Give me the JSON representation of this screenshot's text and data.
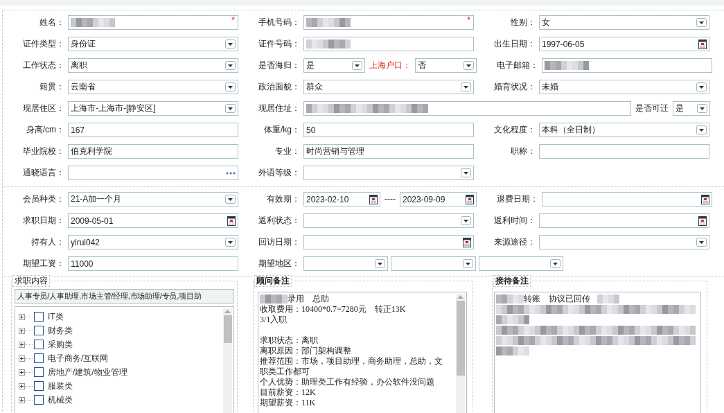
{
  "sections": [
    {
      "rows": [
        {
          "groups": [
            {
              "label": "姓名：",
              "controls": [
                {
                  "kind": "text",
                  "redacted": true,
                  "required_mark": "*"
                }
              ]
            },
            {
              "label": "手机号码：",
              "controls": [
                {
                  "kind": "text",
                  "redacted": true,
                  "required_mark": "*"
                }
              ]
            },
            {
              "label": "性别：",
              "controls": [
                {
                  "kind": "select",
                  "value": "女"
                }
              ]
            }
          ]
        },
        {
          "groups": [
            {
              "label": "证件类型：",
              "controls": [
                {
                  "kind": "select",
                  "value": "身份证"
                }
              ]
            },
            {
              "label": "证件号码：",
              "controls": [
                {
                  "kind": "text",
                  "redacted": true
                }
              ]
            },
            {
              "label": "出生日期：",
              "controls": [
                {
                  "kind": "date",
                  "value": "1997-06-05"
                }
              ]
            }
          ]
        },
        {
          "groups": [
            {
              "label": "工作状态：",
              "controls": [
                {
                  "kind": "select",
                  "value": "离职"
                }
              ]
            },
            {
              "label": "是否海归：",
              "controls": [
                {
                  "kind": "select",
                  "value": "是"
                },
                {
                  "kind": "label",
                  "text": "上海户口：",
                  "highlight": true
                },
                {
                  "kind": "select",
                  "value": "否"
                }
              ]
            },
            {
              "label": "电子邮箱：",
              "controls": [
                {
                  "kind": "text",
                  "redacted": true
                }
              ]
            }
          ]
        },
        {
          "groups": [
            {
              "label": "籍贯：",
              "controls": [
                {
                  "kind": "select",
                  "value": "云南省"
                }
              ]
            },
            {
              "label": "政治面貌：",
              "controls": [
                {
                  "kind": "select",
                  "value": "群众"
                }
              ]
            },
            {
              "label": "婚育状况：",
              "controls": [
                {
                  "kind": "select",
                  "value": "未婚"
                }
              ]
            }
          ]
        },
        {
          "groups": [
            {
              "label": "现居住区：",
              "controls": [
                {
                  "kind": "select",
                  "value": "上海市-上海市-[静安区]"
                }
              ]
            },
            {
              "label": "现居住址：",
              "controls": [
                {
                  "kind": "text",
                  "redacted": true
                },
                {
                  "kind": "label",
                  "text": "是否可迁",
                  "highlight": false
                },
                {
                  "kind": "select",
                  "value": "是"
                }
              ]
            }
          ]
        },
        {
          "groups": [
            {
              "label": "身高/cm：",
              "controls": [
                {
                  "kind": "text",
                  "value": "167"
                }
              ]
            },
            {
              "label": "体重/kg：",
              "controls": [
                {
                  "kind": "text",
                  "value": "50"
                }
              ]
            },
            {
              "label": "文化程度：",
              "controls": [
                {
                  "kind": "select",
                  "value": "本科（全日制）"
                }
              ]
            }
          ]
        },
        {
          "groups": [
            {
              "label": "毕业院校：",
              "controls": [
                {
                  "kind": "text",
                  "value": "伯克利学院"
                }
              ]
            },
            {
              "label": "专业：",
              "controls": [
                {
                  "kind": "text",
                  "value": "时尚营销与管理"
                }
              ]
            },
            {
              "label": "职称：",
              "controls": [
                {
                  "kind": "text"
                }
              ]
            }
          ]
        },
        {
          "groups": [
            {
              "label": "通晓语言：",
              "controls": [
                {
                  "kind": "lookup"
                }
              ]
            },
            {
              "label": "外语等级：",
              "controls": [
                {
                  "kind": "select"
                }
              ]
            }
          ]
        }
      ]
    },
    {
      "rows": [
        {
          "groups": [
            {
              "label": "会员种类：",
              "controls": [
                {
                  "kind": "select",
                  "value": "21-A加一个月"
                }
              ]
            },
            {
              "label": "有效期：",
              "controls": [
                {
                  "kind": "date",
                  "value": "2023-02-10"
                },
                {
                  "kind": "label",
                  "text": "----",
                  "highlight": false
                },
                {
                  "kind": "date",
                  "value": "2023-09-09"
                }
              ]
            },
            {
              "label": "退费日期：",
              "controls": [
                {
                  "kind": "date"
                }
              ]
            }
          ]
        },
        {
          "groups": [
            {
              "label": "求职日期：",
              "controls": [
                {
                  "kind": "date",
                  "value": "2009-05-01"
                }
              ]
            },
            {
              "label": "返利状态：",
              "controls": [
                {
                  "kind": "select"
                }
              ]
            },
            {
              "label": "返利时间：",
              "controls": [
                {
                  "kind": "date"
                }
              ]
            }
          ]
        },
        {
          "groups": [
            {
              "label": "持有人：",
              "controls": [
                {
                  "kind": "select",
                  "value": "yirui042"
                }
              ]
            },
            {
              "label": "回访日期：",
              "controls": [
                {
                  "kind": "date"
                }
              ]
            },
            {
              "label": "来源途径：",
              "controls": [
                {
                  "kind": "select"
                }
              ]
            }
          ]
        },
        {
          "groups": [
            {
              "label": "期望工资：",
              "controls": [
                {
                  "kind": "text",
                  "value": "11000"
                }
              ]
            },
            {
              "label": "期望地区：",
              "controls": [
                {
                  "kind": "select"
                },
                {
                  "kind": "select"
                },
                {
                  "kind": "select"
                }
              ]
            }
          ]
        }
      ]
    }
  ],
  "job_intent": {
    "legend": "求职内容",
    "summary": "人事专员/人事助理,市场主管/经理,市场助理/专员,项目助",
    "categories": [
      {
        "label": "IT类",
        "expanded": false,
        "checked": false
      },
      {
        "label": "财务类",
        "expanded": false,
        "checked": false
      },
      {
        "label": "采购类",
        "expanded": false,
        "checked": false
      },
      {
        "label": "电子商务/互联网",
        "expanded": false,
        "checked": false
      },
      {
        "label": "房地产/建筑/物业管理",
        "expanded": false,
        "checked": false
      },
      {
        "label": "服装类",
        "expanded": false,
        "checked": false
      },
      {
        "label": "机械类",
        "expanded": false,
        "checked": false
      }
    ]
  },
  "notes": [
    {
      "legend": "顾问备注",
      "kind": "scroll",
      "lines": [
        {
          "kind": "text",
          "text": "录用　总助",
          "redacted_before": true
        },
        {
          "kind": "text",
          "text": "收取费用：10400*0.7=7280元　转正13K"
        },
        {
          "kind": "text",
          "text": "3/1入职"
        },
        {
          "kind": "text",
          "text": "求职状态：离职",
          "space_before": true
        },
        {
          "kind": "text",
          "text": "离职原因：部门架构调整"
        },
        {
          "kind": "text",
          "text": "推荐范围：市场，项目助理，商务助理，总助，文职类工作都可"
        },
        {
          "kind": "text",
          "text": "个人优势：助理类工作有经验，办公软件没问题"
        },
        {
          "kind": "text",
          "text": "目前薪资：12K"
        },
        {
          "kind": "text",
          "text": "期望薪资：11K"
        }
      ]
    },
    {
      "legend": "接待备注",
      "kind": "plain",
      "lines": [
        {
          "kind": "text",
          "text": "转账　协议已回传",
          "redacted_before": true,
          "redacted_after": true
        },
        {
          "kind": "redacted",
          "long": true
        },
        {
          "kind": "redacted",
          "long": false
        },
        {
          "kind": "redacted",
          "long": true
        },
        {
          "kind": "redacted",
          "long": true
        },
        {
          "kind": "redacted",
          "long": false
        }
      ]
    }
  ]
}
